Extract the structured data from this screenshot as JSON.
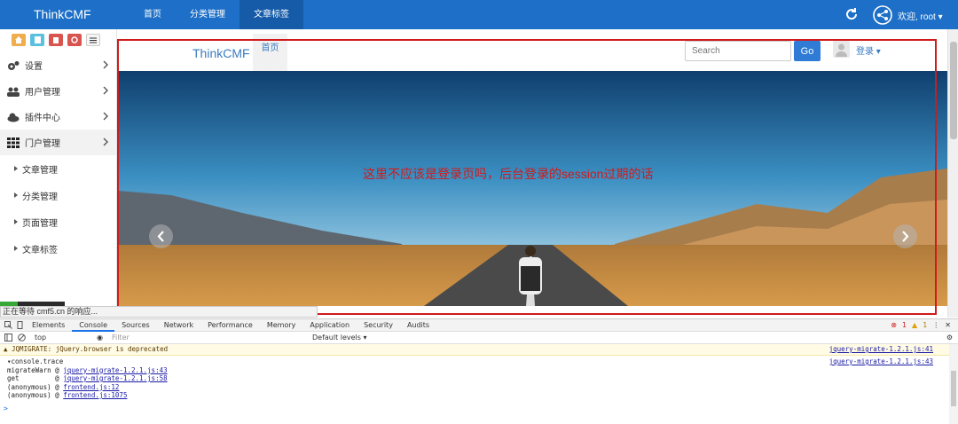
{
  "topbar": {
    "brand": "ThinkCMF",
    "nav": [
      {
        "label": "首页",
        "active": false
      },
      {
        "label": "分类管理",
        "active": false
      },
      {
        "label": "文章标签",
        "active": true
      }
    ],
    "user_label": "欢迎, root ▾"
  },
  "sidebar": {
    "shortcut_colors": [
      "#f0ad4e",
      "#5bc0de",
      "#d9534f",
      "#d9534f",
      "#f5f5f5"
    ],
    "menu": [
      {
        "label": "设置",
        "icon": "gears-icon"
      },
      {
        "label": "用户管理",
        "icon": "users-icon"
      },
      {
        "label": "插件中心",
        "icon": "cloud-icon"
      },
      {
        "label": "门户管理",
        "icon": "grid-icon",
        "open": true
      }
    ],
    "submenu": [
      "文章管理",
      "分类管理",
      "页面管理",
      "文章标签"
    ]
  },
  "frame": {
    "brand": "ThinkCMF",
    "home": "首页",
    "search_placeholder": "Search",
    "go_label": "Go",
    "login_label": "登录 ▾"
  },
  "annotation": "这里不应该是登录页吗，后台登录的session过期的话",
  "status_text": "正在等待 cmf5.cn 的响应...",
  "devtools": {
    "tabs": [
      "Elements",
      "Console",
      "Sources",
      "Network",
      "Performance",
      "Memory",
      "Application",
      "Security",
      "Audits"
    ],
    "active_tab": "Console",
    "error_count": "1",
    "warn_count": "1",
    "context": "top",
    "filter_placeholder": "Filter",
    "levels": "Default levels ▾",
    "warning": "▲ JQMIGRATE: jQuery.browser is deprecated",
    "warning_src": "jquery-migrate-1.2.1.js:41",
    "trace_title": "▾console.trace",
    "trace_src": "jquery-migrate-1.2.1.js:43",
    "trace": [
      {
        "fn": "migrateWarn @ ",
        "link": "jquery-migrate-1.2.1.js:43"
      },
      {
        "fn": "get         @ ",
        "link": "jquery-migrate-1.2.1.js:58"
      },
      {
        "fn": "(anonymous) @ ",
        "link": "frontend.js:12"
      },
      {
        "fn": "(anonymous) @ ",
        "link": "frontend.js:1075"
      }
    ],
    "prompt": ">"
  }
}
